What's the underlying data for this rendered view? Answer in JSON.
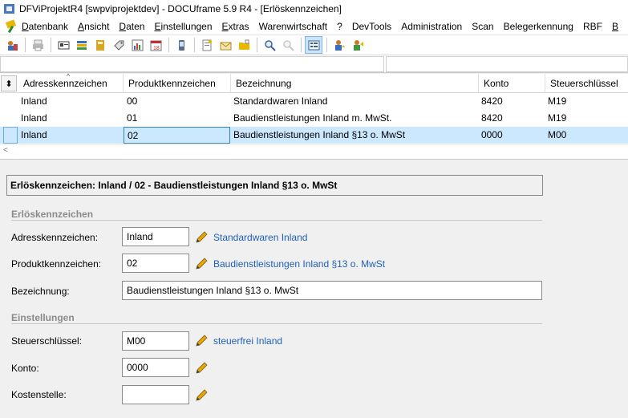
{
  "window": {
    "title": "DFViProjektR4 [swpviprojektdev] - DOCUframe 5.9 R4 - [Erlöskennzeichen]"
  },
  "menu": [
    {
      "label": "Datenbank",
      "ul": "D",
      "rest": "atenbank"
    },
    {
      "label": "Ansicht",
      "ul": "A",
      "rest": "nsicht"
    },
    {
      "label": "Daten",
      "ul": "D",
      "rest": "aten"
    },
    {
      "label": "Einstellungen",
      "ul": "E",
      "rest": "instellungen"
    },
    {
      "label": "Extras",
      "ul": "E",
      "rest": "xtras"
    },
    {
      "label": "Warenwirtschaft",
      "ul": "",
      "rest": "Warenwirtschaft"
    },
    {
      "label": "?",
      "ul": "",
      "rest": "?"
    },
    {
      "label": "DevTools",
      "ul": "",
      "rest": "DevTools"
    },
    {
      "label": "Administration",
      "ul": "",
      "rest": "Administration"
    },
    {
      "label": "Scan",
      "ul": "",
      "rest": "Scan"
    },
    {
      "label": "Belegerkennung",
      "ul": "",
      "rest": "Belegerkennung"
    },
    {
      "label": "RBF",
      "ul": "",
      "rest": "RBF"
    },
    {
      "label": "B",
      "ul": "B",
      "rest": ""
    }
  ],
  "toolbar": {
    "icons": [
      "users-icon",
      "print-icon",
      "card-icon",
      "list-icon",
      "book-icon",
      "tag-icon",
      "chart-icon",
      "calendar-icon",
      "phone-icon",
      "new-doc-icon",
      "mail-icon",
      "folder-icon",
      "search-icon",
      "search-disabled-icon",
      "form-view-icon",
      "user-assign-icon",
      "user-move-icon"
    ]
  },
  "grid": {
    "columns": [
      "Adresskennzeichen",
      "Produktkennzeichen",
      "Bezeichnung",
      "Konto",
      "Steuerschlüssel"
    ],
    "rows": [
      [
        "Inland",
        "00",
        "Standardwaren Inland",
        "8420",
        "M19"
      ],
      [
        "Inland",
        "01",
        "Baudienstleistungen Inland m. MwSt.",
        "8420",
        "M19"
      ],
      [
        "Inland",
        "02",
        "Baudienstleistungen Inland §13 o. MwSt",
        "0000",
        "M00"
      ]
    ],
    "selected_row": 2
  },
  "form": {
    "header": "Erlöskennzeichen:   Inland / 02 - Baudienstleistungen Inland §13 o. MwSt",
    "section1": "Erlöskennzeichen",
    "section2": "Einstellungen",
    "fields": {
      "adress_label": "Adresskennzeichen:",
      "adress_value": "Inland",
      "adress_link": "Standardwaren Inland",
      "produkt_label": "Produktkennzeichen:",
      "produkt_value": "02",
      "produkt_link": "Baudienstleistungen Inland §13 o. MwSt",
      "bez_label": "Bezeichnung:",
      "bez_value": "Baudienstleistungen Inland §13 o. MwSt",
      "steuer_label": "Steuerschlüssel:",
      "steuer_value": "M00",
      "steuer_link": "steuerfrei Inland",
      "konto_label": "Konto:",
      "konto_value": "0000",
      "kosten_label": "Kostenstelle:",
      "kosten_value": ""
    }
  },
  "colors": {
    "selection": "#cce8ff",
    "link": "#1f5fb4",
    "section": "#8a8a8a"
  }
}
